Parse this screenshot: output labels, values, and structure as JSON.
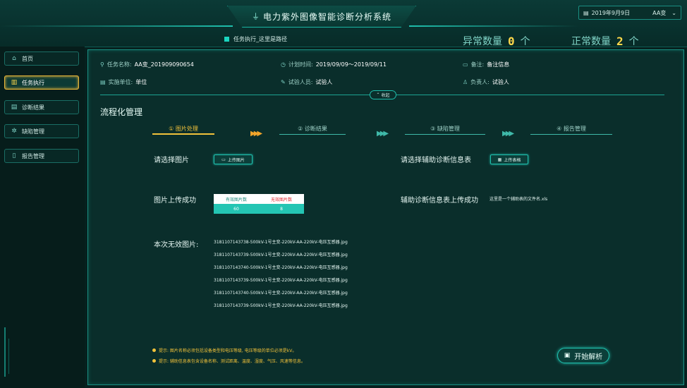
{
  "header": {
    "title": "电力紫外图像智能诊断分析系统",
    "breadcrumb": "任务执行_这里是路径",
    "date": "2019年9月9日",
    "station": "AA变",
    "abnormal_label": "异常数量",
    "abnormal_count": "0",
    "normal_label": "正常数量",
    "normal_count": "2",
    "count_unit": "个"
  },
  "sidebar": {
    "items": [
      {
        "label": "首页",
        "icon": "home-icon"
      },
      {
        "label": "任务执行",
        "icon": "task-icon"
      },
      {
        "label": "诊断结果",
        "icon": "result-icon"
      },
      {
        "label": "缺陷管理",
        "icon": "defect-icon"
      },
      {
        "label": "报告管理",
        "icon": "report-icon"
      }
    ],
    "active_index": 1
  },
  "task": {
    "name_label": "任务名称:",
    "name_value": "AA变_201909090654",
    "time_label": "计划时间:",
    "time_value": "2019/09/09～2019/09/11",
    "remark_label": "备注:",
    "remark_value": "备注信息",
    "unit_label": "实施单位:",
    "unit_value": "单位",
    "tester_label": "试验人员:",
    "tester_value": "试验人",
    "owner_label": "负责人:",
    "owner_value": "试验人",
    "collapse_label": "收起"
  },
  "flow": {
    "title": "流程化管理",
    "steps": [
      {
        "label": "① 图片处理",
        "active": true
      },
      {
        "label": "② 诊断结果",
        "active": false
      },
      {
        "label": "③ 缺陷管理",
        "active": false
      },
      {
        "label": "④ 报告管理",
        "active": false
      }
    ]
  },
  "upload": {
    "select_image_label": "请选择图片",
    "upload_image_btn": "上传图片",
    "select_table_label": "请选择辅助诊断信息表",
    "upload_table_btn": "上传表格",
    "image_success_label": "图片上传成功",
    "table_success_label": "辅助诊断信息表上传成功",
    "table_filename": "这里是一个辅助表的文件名.xls",
    "valid_header": "有效图片数",
    "invalid_header": "无效图片数",
    "valid_count": "60",
    "invalid_count": "8",
    "invalid_list_label": "本次无效图片:",
    "invalid_files": [
      "3181107143738-500kV-1号主变-220kV-AA-220kV-电压互感器.jpg",
      "3181107143739-500kV-1号主变-220kV-AA-220kV-电压互感器.jpg",
      "3181107143740-500kV-1号主变-220kV-AA-220kV-电压互感器.jpg",
      "3181107143739-500kV-1号主变-220kV-AA-220kV-电压互感器.jpg",
      "3181107143740-500kV-1号主变-220kV-AA-220kV-电压互感器.jpg",
      "3181107143739-500kV-1号主变-220kV-AA-220kV-电压互感器.jpg"
    ]
  },
  "tips": [
    "提示: 图片名称必须包括设备类型和电压等级, 电压等级的单位必须是kV。",
    "提示: 辅助信息表包含设备名称、测试距离、温度、湿度、气压、风速等信息。"
  ],
  "start_button": "开始解析",
  "colors": {
    "accent": "#1fbfad",
    "active": "#f2c23a",
    "count": "#ffd84a",
    "bg": "#06211f"
  }
}
